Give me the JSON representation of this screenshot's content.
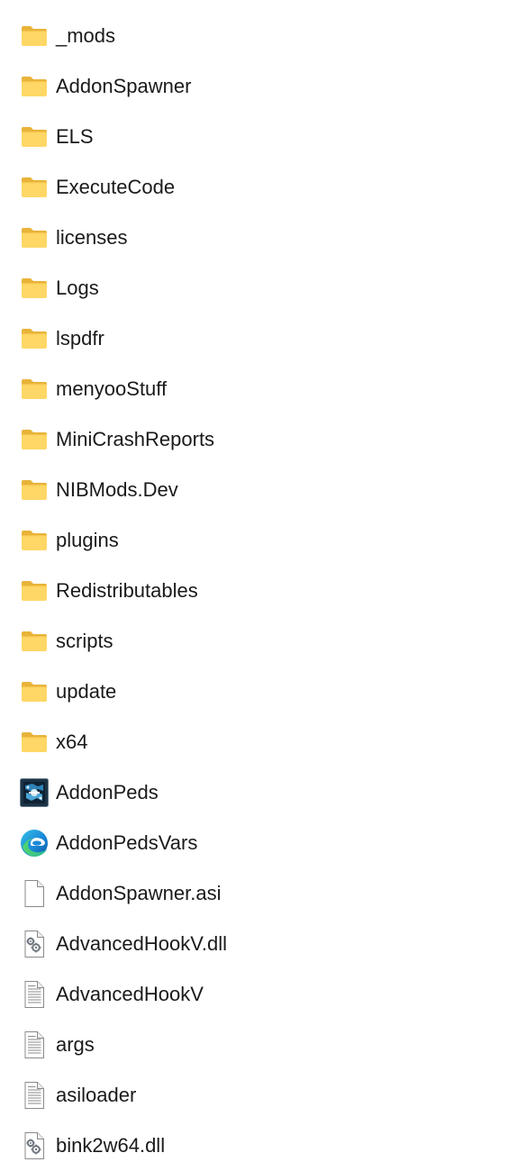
{
  "items": [
    {
      "name": "_mods",
      "type": "folder",
      "icon": "folder-icon"
    },
    {
      "name": "AddonSpawner",
      "type": "folder",
      "icon": "folder-icon"
    },
    {
      "name": "ELS",
      "type": "folder",
      "icon": "folder-icon"
    },
    {
      "name": "ExecuteCode",
      "type": "folder",
      "icon": "folder-icon"
    },
    {
      "name": "licenses",
      "type": "folder",
      "icon": "folder-icon"
    },
    {
      "name": "Logs",
      "type": "folder",
      "icon": "folder-icon"
    },
    {
      "name": "lspdfr",
      "type": "folder",
      "icon": "folder-icon"
    },
    {
      "name": "menyooStuff",
      "type": "folder",
      "icon": "folder-icon"
    },
    {
      "name": "MiniCrashReports",
      "type": "folder",
      "icon": "folder-icon"
    },
    {
      "name": "NIBMods.Dev",
      "type": "folder",
      "icon": "folder-icon"
    },
    {
      "name": "plugins",
      "type": "folder",
      "icon": "folder-icon"
    },
    {
      "name": "Redistributables",
      "type": "folder",
      "icon": "folder-icon"
    },
    {
      "name": "scripts",
      "type": "folder",
      "icon": "folder-icon"
    },
    {
      "name": "update",
      "type": "folder",
      "icon": "folder-icon"
    },
    {
      "name": "x64",
      "type": "folder",
      "icon": "folder-icon"
    },
    {
      "name": "AddonPeds",
      "type": "app",
      "icon": "app-thumbnail-icon"
    },
    {
      "name": "AddonPedsVars",
      "type": "edge",
      "icon": "edge-browser-icon"
    },
    {
      "name": "AddonSpawner.asi",
      "type": "blank",
      "icon": "blank-file-icon"
    },
    {
      "name": "AdvancedHookV.dll",
      "type": "dll",
      "icon": "dll-gear-file-icon"
    },
    {
      "name": "AdvancedHookV",
      "type": "text",
      "icon": "text-file-icon"
    },
    {
      "name": "args",
      "type": "text",
      "icon": "text-file-icon"
    },
    {
      "name": "asiloader",
      "type": "text",
      "icon": "text-file-icon"
    },
    {
      "name": "bink2w64.dll",
      "type": "dll",
      "icon": "dll-gear-file-icon"
    }
  ],
  "colors": {
    "folder_back": "#e8b339",
    "folder_front": "#ffd766",
    "text": "#1a1a1a",
    "file_outline": "#8a8a8a"
  }
}
